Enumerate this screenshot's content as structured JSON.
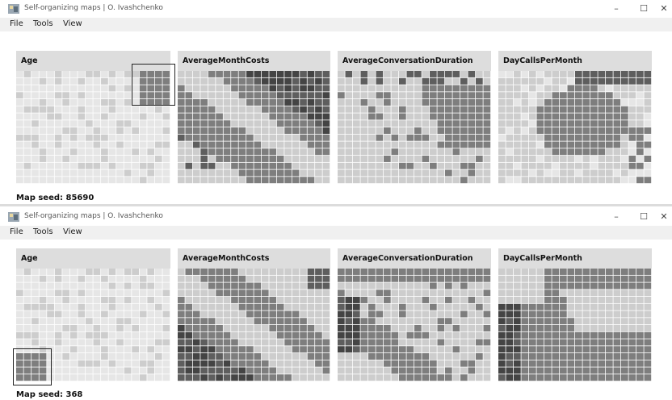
{
  "windows": [
    {
      "title": "Self-organizing maps | O. Ivashchenko",
      "menu": [
        "File",
        "Tools",
        "View"
      ],
      "panels": [
        {
          "label": "Age",
          "id": "age"
        },
        {
          "label": "AverageMonthCosts",
          "id": "amc"
        },
        {
          "label": "AverageConversationDuration",
          "id": "acd"
        },
        {
          "label": "DayCallsPerMonth",
          "id": "dcpm"
        }
      ],
      "seed_label": "Map seed: 85690"
    },
    {
      "title": "Self-organizing maps | O. Ivashchenko",
      "menu": [
        "File",
        "Tools",
        "View"
      ],
      "panels": [
        {
          "label": "Age",
          "id": "age"
        },
        {
          "label": "AverageMonthCosts",
          "id": "amc"
        },
        {
          "label": "AverageConversationDuration",
          "id": "acd"
        },
        {
          "label": "DayCallsPerMonth",
          "id": "dcpm"
        }
      ],
      "seed_label": "Map seed: 368"
    }
  ],
  "window_controls": {
    "minimize": "–",
    "maximize": "☐",
    "close": "✕"
  },
  "colors": {
    "light": "#e6e6e6",
    "mid": "#cdcdcd",
    "dark": "#7e7e7e",
    "darker": "#5e5e5e",
    "darkest": "#444444",
    "grid": "#ffffff"
  },
  "icons": {
    "app": "app-icon"
  }
}
